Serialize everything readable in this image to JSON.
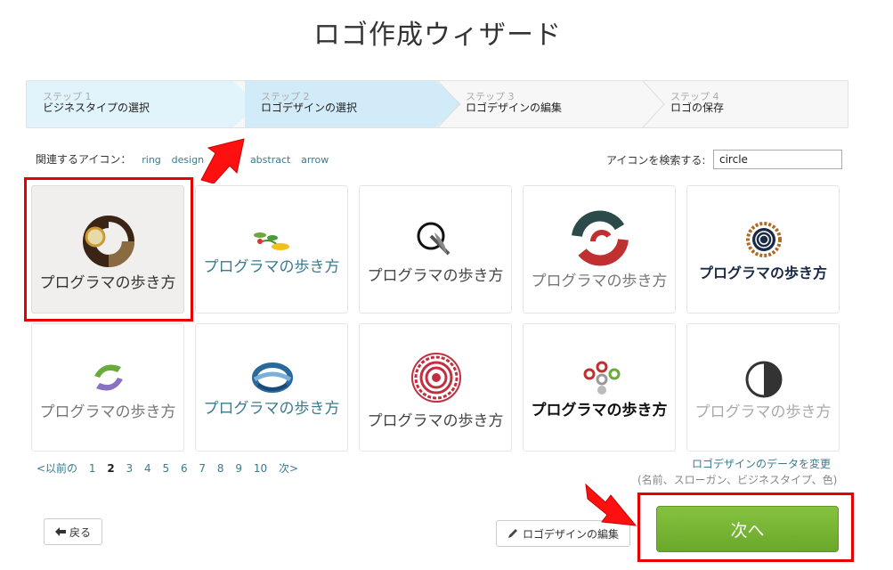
{
  "title": "ロゴ作成ウィザード",
  "steps": [
    {
      "no": "ステップ 1",
      "label": "ビジネスタイプの選択",
      "state": "done"
    },
    {
      "no": "ステップ 2",
      "label": "ロゴデザインの選択",
      "state": "active"
    },
    {
      "no": "ステップ 3",
      "label": "ロゴデザインの編集",
      "state": "pending"
    },
    {
      "no": "ステップ 4",
      "label": "ロゴの保存",
      "state": "pending"
    }
  ],
  "related": {
    "label": "関連するアイコン：",
    "tags": [
      "ring",
      "design",
      "abstract",
      "arrow"
    ]
  },
  "search": {
    "label": "アイコンを検索する:",
    "value": "circle"
  },
  "logos": [
    {
      "name": "プログラマの歩き方",
      "icon": "brown-ring-icon",
      "color": "#7a6a5a",
      "selected": true
    },
    {
      "name": "プログラマの歩き方",
      "icon": "sprout-icon",
      "color": "#3a7a8e"
    },
    {
      "name": "プログラマの歩き方",
      "icon": "orbit-q-icon",
      "color": "#555555"
    },
    {
      "name": "プログラマの歩き方",
      "icon": "swirl-ring-icon",
      "color": "#777777"
    },
    {
      "name": "プログラマの歩き方",
      "icon": "gear-ring-icon",
      "color": "#1a2a44"
    },
    {
      "name": "プログラマの歩き方",
      "icon": "green-purple-loop-icon",
      "color": "#777777"
    },
    {
      "name": "プログラマの歩き方",
      "icon": "blue-wave-ring-icon",
      "color": "#3a7a8e"
    },
    {
      "name": "プログラマの歩き方",
      "icon": "red-target-icon",
      "color": "#555555"
    },
    {
      "name": "プログラマの歩き方",
      "icon": "colored-dots-icon",
      "color": "#111111"
    },
    {
      "name": "プログラマの歩き方",
      "icon": "half-circle-icon",
      "color": "#aaaaaa"
    }
  ],
  "pager": {
    "prev": "<以前の",
    "pages": [
      "1",
      "2",
      "3",
      "4",
      "5",
      "6",
      "7",
      "8",
      "9",
      "10"
    ],
    "current": "2",
    "next": "次>"
  },
  "change_data": {
    "link": "ロゴデザインのデータを変更",
    "sub": "(名前、スローガン、ビジネスタイプ、色)"
  },
  "buttons": {
    "back": "戻る",
    "edit": "ロゴデザインの編集",
    "next": "次へ"
  },
  "colors": {
    "accent": "#3a7a8e",
    "next_button": "#78b535",
    "highlight": "#e60000"
  }
}
